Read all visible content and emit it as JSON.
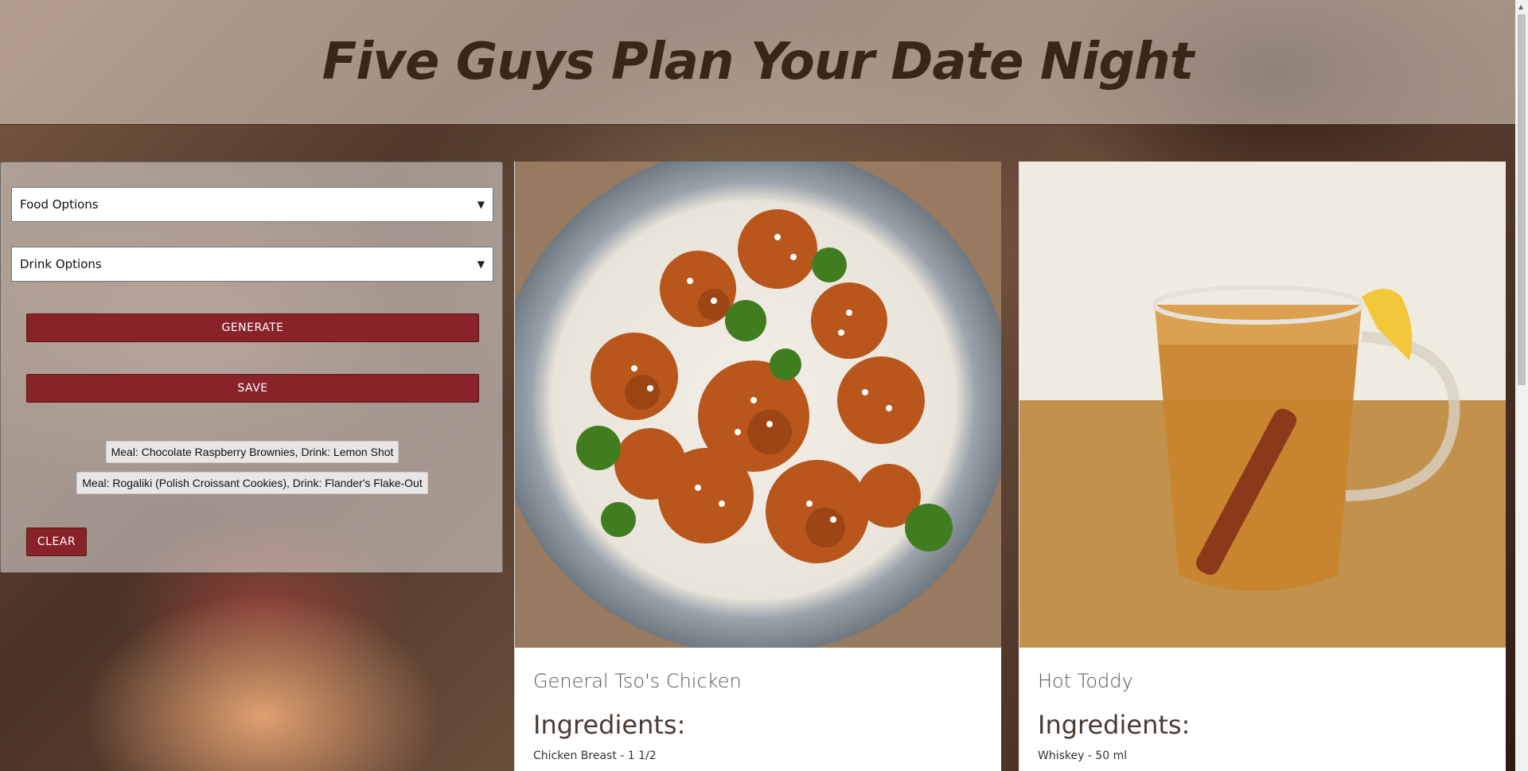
{
  "header": {
    "title": "Five Guys Plan Your Date Night"
  },
  "controls": {
    "food_select": "Food Options",
    "drink_select": "Drink Options",
    "generate_label": "GENERATE",
    "save_label": "SAVE",
    "clear_label": "CLEAR"
  },
  "saved": [
    "Meal: Chocolate Raspberry Brownies, Drink: Lemon Shot",
    "Meal: Rogaliki (Polish Croissant Cookies), Drink: Flander's Flake-Out"
  ],
  "cards": [
    {
      "name": "General Tso's Chicken",
      "ingredients_heading": "Ingredients:",
      "first_ingredient": "Chicken Breast - 1 1/2"
    },
    {
      "name": "Hot Toddy",
      "ingredients_heading": "Ingredients:",
      "first_ingredient": "Whiskey - 50 ml"
    }
  ],
  "colors": {
    "accent": "#8a2229",
    "title": "#3a2616"
  }
}
